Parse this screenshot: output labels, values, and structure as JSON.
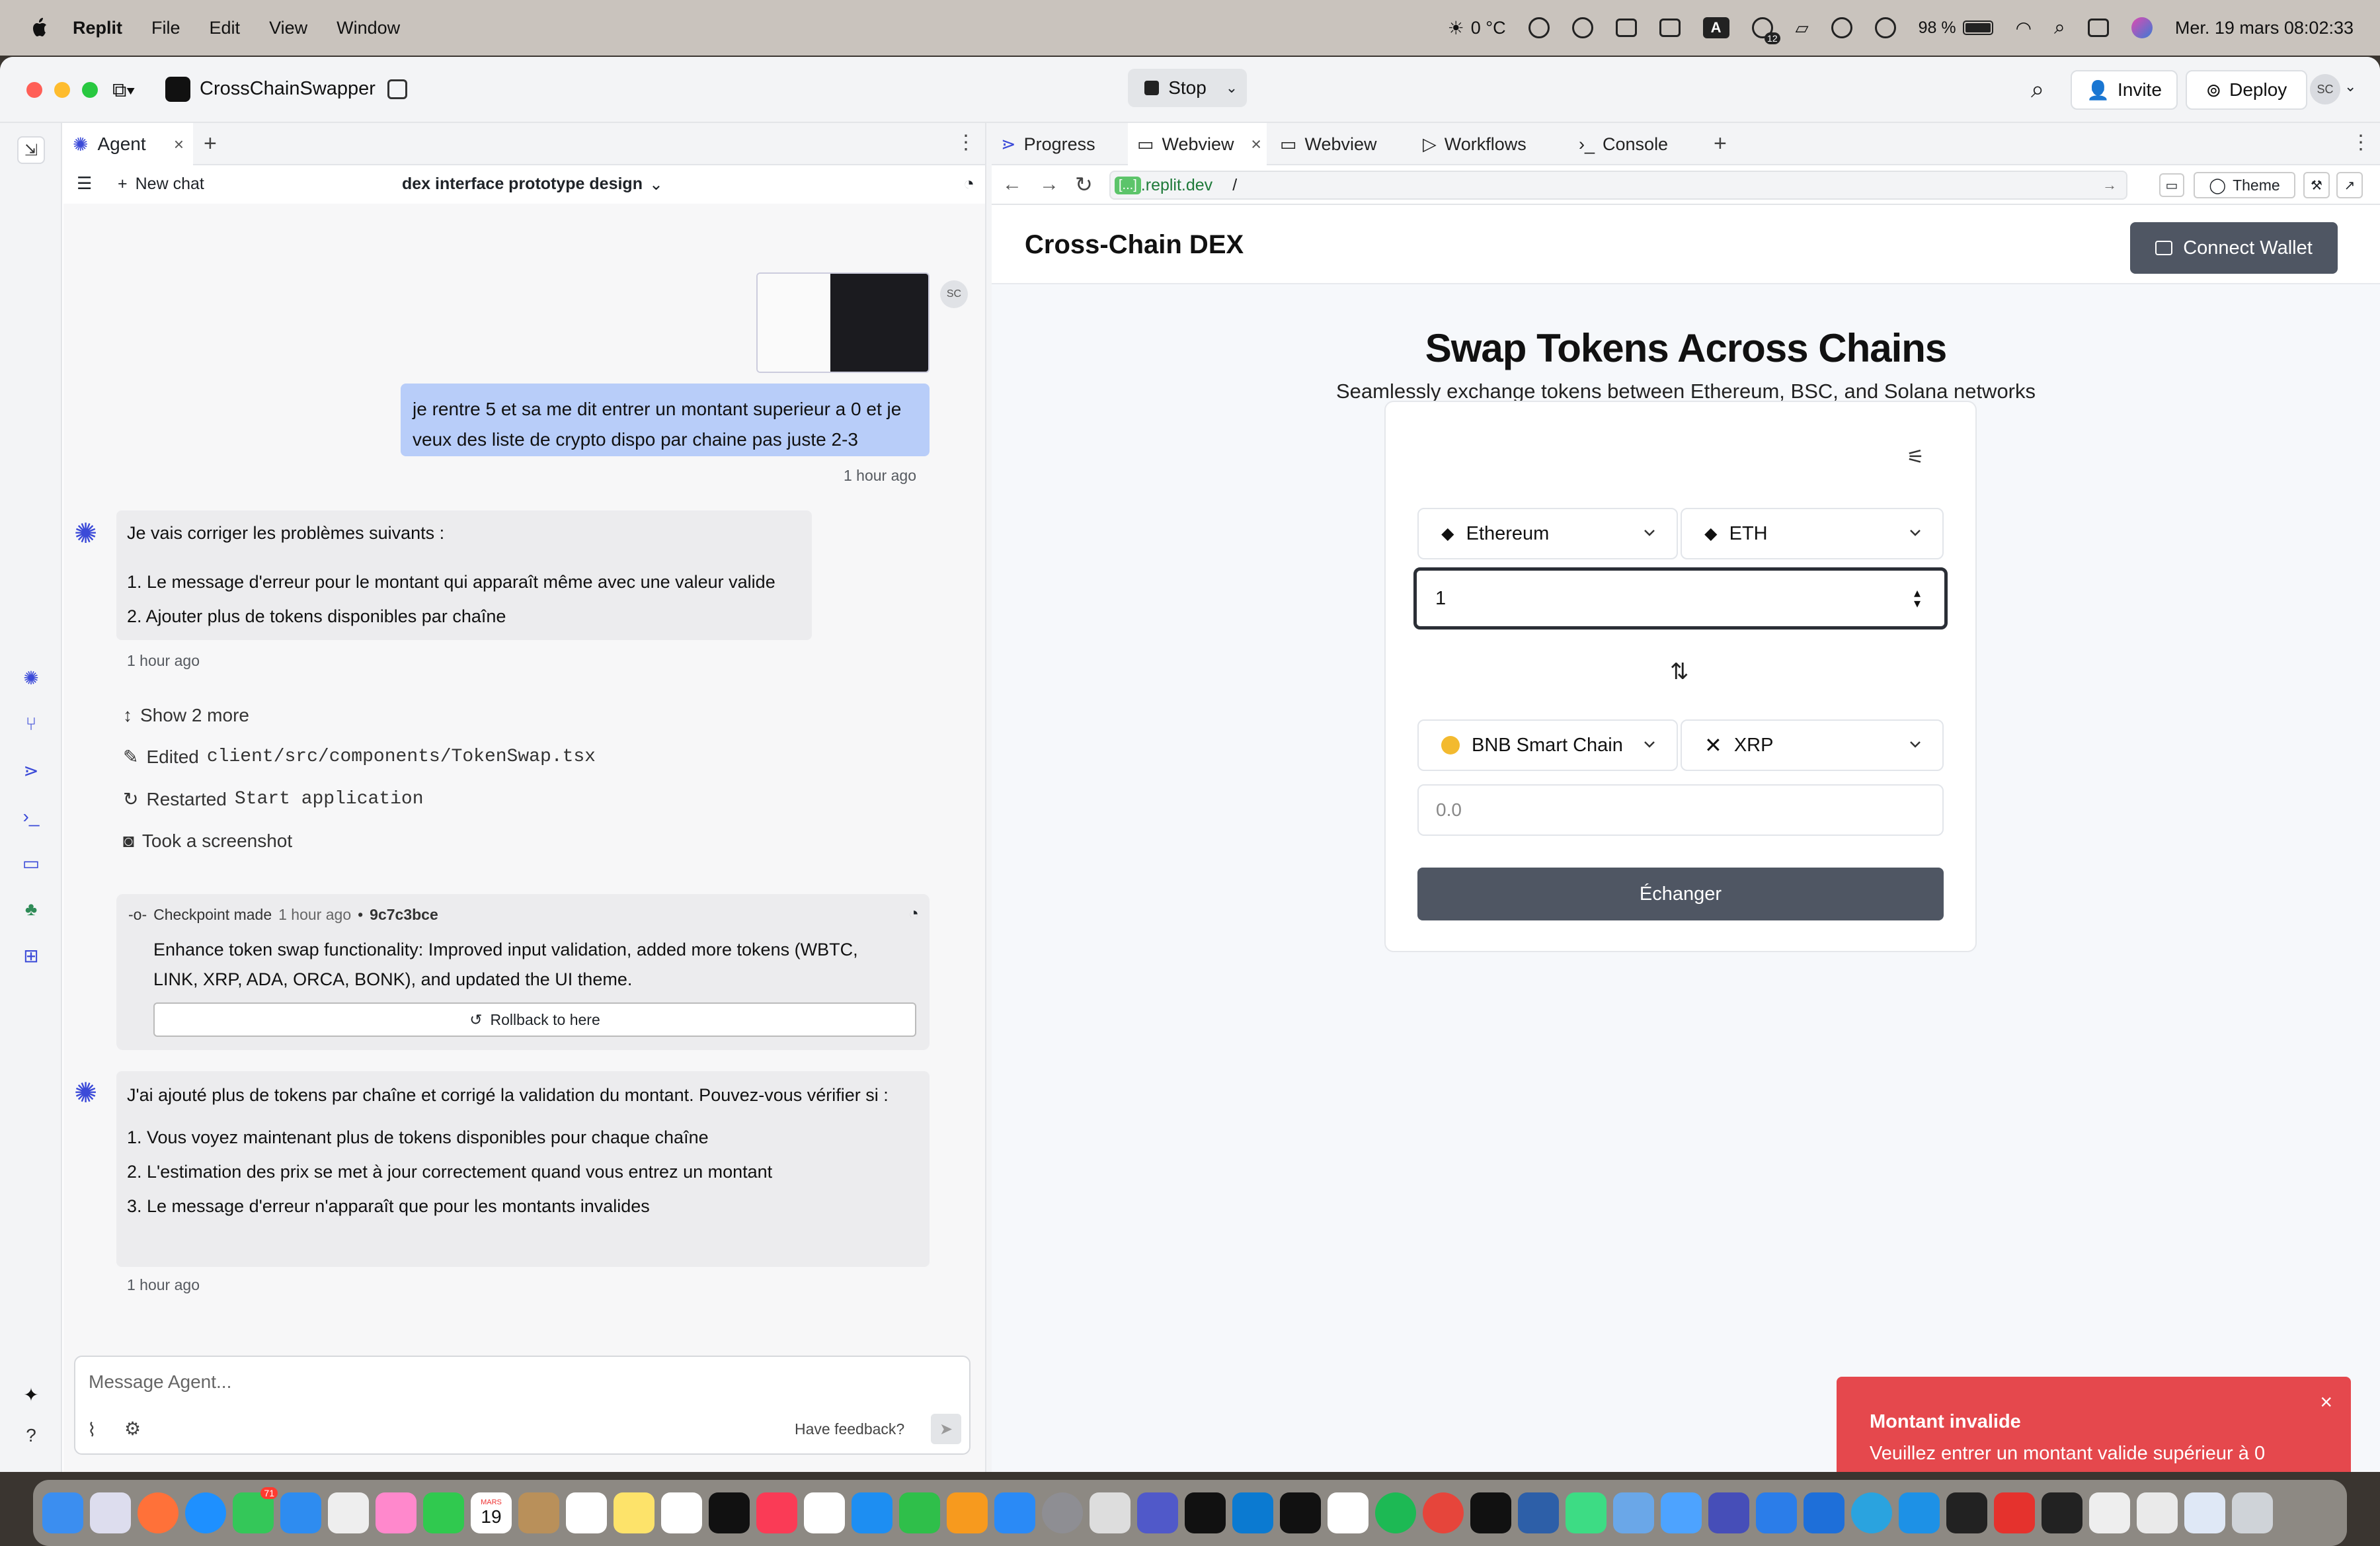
{
  "menubar": {
    "app": "Replit",
    "items": [
      "File",
      "Edit",
      "View",
      "Window"
    ],
    "weather": "0 °C",
    "battery": "98 %",
    "input_source": "A",
    "notif_count": "12",
    "datetime": "Mer. 19 mars 08:02:33"
  },
  "titlebar": {
    "project": "CrossChainSwapper",
    "stop": "Stop",
    "invite": "Invite",
    "deploy": "Deploy",
    "avatar": "SC"
  },
  "agent": {
    "tab": "Agent",
    "new_chat": "New chat",
    "chat_title": "dex interface prototype design",
    "user_avatar": "SC",
    "user_msg": "je rentre 5 et sa me dit entrer un montant superieur a 0 et je veux des liste de crypto dispo par chaine pas juste 2-3",
    "user_ts": "1 hour ago",
    "reply1": {
      "intro": "Je vais corriger les problèmes suivants :",
      "items": [
        "1. Le message d'erreur pour le montant qui apparaît même avec une valeur valide",
        "2. Ajouter plus de tokens disponibles par chaîne"
      ],
      "ts": "1 hour ago"
    },
    "actions": {
      "show_more": "Show 2 more",
      "edited_label": "Edited",
      "edited_file": "client/src/components/TokenSwap.tsx",
      "restarted_label": "Restarted",
      "restarted_target": "Start application",
      "screenshot": "Took a screenshot"
    },
    "checkpoint": {
      "label": "Checkpoint made",
      "ts": "1 hour ago",
      "hash": "9c7c3bce",
      "text": "Enhance token swap functionality: Improved input validation, added more tokens (WBTC, LINK, XRP, ADA, ORCA, BONK), and updated the UI theme.",
      "rollback": "Rollback to here"
    },
    "reply2": {
      "intro": "J'ai ajouté plus de tokens par chaîne et corrigé la validation du montant. Pouvez-vous vérifier si :",
      "items": [
        "1. Vous voyez maintenant plus de tokens disponibles pour chaque chaîne",
        "2. L'estimation des prix se met à jour correctement quand vous entrez un montant",
        "3. Le message d'erreur n'apparaît que pour les montants invalides"
      ],
      "ts": "1 hour ago"
    },
    "input_placeholder": "Message Agent...",
    "feedback": "Have feedback?"
  },
  "right": {
    "tabs": [
      "Progress",
      "Webview",
      "Webview",
      "Workflows",
      "Console"
    ],
    "url_badge": "[...]",
    "url_domain": ".replit.dev",
    "url_path": "/",
    "theme_btn": "Theme"
  },
  "dex": {
    "brand": "Cross-Chain DEX",
    "connect": "Connect Wallet",
    "headline": "Swap Tokens Across Chains",
    "subline": "Seamlessly exchange tokens between Ethereum, BSC, and Solana networks",
    "from_chain": "Ethereum",
    "from_token": "ETH",
    "amount": "1",
    "to_chain": "BNB Smart Chain",
    "to_token": "XRP",
    "output_placeholder": "0.0",
    "swap_button": "Échanger"
  },
  "toast": {
    "title": "Montant invalide",
    "body": "Veuillez entrer un montant valide supérieur à 0"
  },
  "dock": {
    "mail_badge": "71",
    "calendar_month": "MARS",
    "calendar_day": "19"
  },
  "colors": {
    "accent_user_bubble": "#b8cdf9",
    "toast_red": "#e5484d",
    "swap_button": "#4f5663",
    "connect_button": "#4f5663"
  }
}
